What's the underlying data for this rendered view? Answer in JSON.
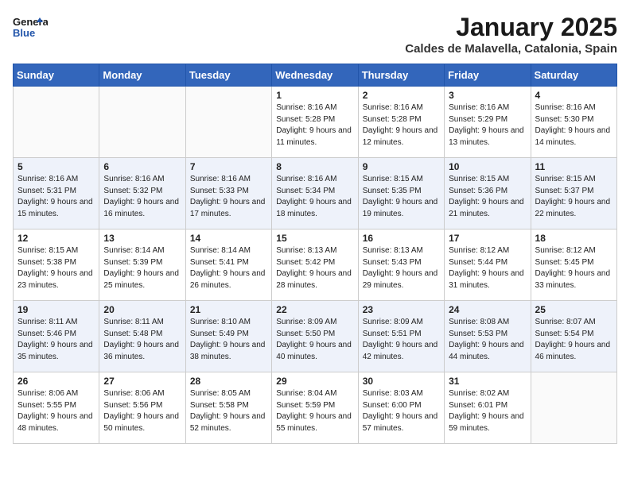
{
  "header": {
    "logo_line1": "General",
    "logo_line2": "Blue",
    "month_title": "January 2025",
    "location": "Caldes de Malavella, Catalonia, Spain"
  },
  "weekdays": [
    "Sunday",
    "Monday",
    "Tuesday",
    "Wednesday",
    "Thursday",
    "Friday",
    "Saturday"
  ],
  "weeks": [
    [
      {
        "day": "",
        "info": ""
      },
      {
        "day": "",
        "info": ""
      },
      {
        "day": "",
        "info": ""
      },
      {
        "day": "1",
        "sunrise": "8:16 AM",
        "sunset": "5:28 PM",
        "daylight": "9 hours and 11 minutes."
      },
      {
        "day": "2",
        "sunrise": "8:16 AM",
        "sunset": "5:28 PM",
        "daylight": "9 hours and 12 minutes."
      },
      {
        "day": "3",
        "sunrise": "8:16 AM",
        "sunset": "5:29 PM",
        "daylight": "9 hours and 13 minutes."
      },
      {
        "day": "4",
        "sunrise": "8:16 AM",
        "sunset": "5:30 PM",
        "daylight": "9 hours and 14 minutes."
      }
    ],
    [
      {
        "day": "5",
        "sunrise": "8:16 AM",
        "sunset": "5:31 PM",
        "daylight": "9 hours and 15 minutes."
      },
      {
        "day": "6",
        "sunrise": "8:16 AM",
        "sunset": "5:32 PM",
        "daylight": "9 hours and 16 minutes."
      },
      {
        "day": "7",
        "sunrise": "8:16 AM",
        "sunset": "5:33 PM",
        "daylight": "9 hours and 17 minutes."
      },
      {
        "day": "8",
        "sunrise": "8:16 AM",
        "sunset": "5:34 PM",
        "daylight": "9 hours and 18 minutes."
      },
      {
        "day": "9",
        "sunrise": "8:15 AM",
        "sunset": "5:35 PM",
        "daylight": "9 hours and 19 minutes."
      },
      {
        "day": "10",
        "sunrise": "8:15 AM",
        "sunset": "5:36 PM",
        "daylight": "9 hours and 21 minutes."
      },
      {
        "day": "11",
        "sunrise": "8:15 AM",
        "sunset": "5:37 PM",
        "daylight": "9 hours and 22 minutes."
      }
    ],
    [
      {
        "day": "12",
        "sunrise": "8:15 AM",
        "sunset": "5:38 PM",
        "daylight": "9 hours and 23 minutes."
      },
      {
        "day": "13",
        "sunrise": "8:14 AM",
        "sunset": "5:39 PM",
        "daylight": "9 hours and 25 minutes."
      },
      {
        "day": "14",
        "sunrise": "8:14 AM",
        "sunset": "5:41 PM",
        "daylight": "9 hours and 26 minutes."
      },
      {
        "day": "15",
        "sunrise": "8:13 AM",
        "sunset": "5:42 PM",
        "daylight": "9 hours and 28 minutes."
      },
      {
        "day": "16",
        "sunrise": "8:13 AM",
        "sunset": "5:43 PM",
        "daylight": "9 hours and 29 minutes."
      },
      {
        "day": "17",
        "sunrise": "8:12 AM",
        "sunset": "5:44 PM",
        "daylight": "9 hours and 31 minutes."
      },
      {
        "day": "18",
        "sunrise": "8:12 AM",
        "sunset": "5:45 PM",
        "daylight": "9 hours and 33 minutes."
      }
    ],
    [
      {
        "day": "19",
        "sunrise": "8:11 AM",
        "sunset": "5:46 PM",
        "daylight": "9 hours and 35 minutes."
      },
      {
        "day": "20",
        "sunrise": "8:11 AM",
        "sunset": "5:48 PM",
        "daylight": "9 hours and 36 minutes."
      },
      {
        "day": "21",
        "sunrise": "8:10 AM",
        "sunset": "5:49 PM",
        "daylight": "9 hours and 38 minutes."
      },
      {
        "day": "22",
        "sunrise": "8:09 AM",
        "sunset": "5:50 PM",
        "daylight": "9 hours and 40 minutes."
      },
      {
        "day": "23",
        "sunrise": "8:09 AM",
        "sunset": "5:51 PM",
        "daylight": "9 hours and 42 minutes."
      },
      {
        "day": "24",
        "sunrise": "8:08 AM",
        "sunset": "5:53 PM",
        "daylight": "9 hours and 44 minutes."
      },
      {
        "day": "25",
        "sunrise": "8:07 AM",
        "sunset": "5:54 PM",
        "daylight": "9 hours and 46 minutes."
      }
    ],
    [
      {
        "day": "26",
        "sunrise": "8:06 AM",
        "sunset": "5:55 PM",
        "daylight": "9 hours and 48 minutes."
      },
      {
        "day": "27",
        "sunrise": "8:06 AM",
        "sunset": "5:56 PM",
        "daylight": "9 hours and 50 minutes."
      },
      {
        "day": "28",
        "sunrise": "8:05 AM",
        "sunset": "5:58 PM",
        "daylight": "9 hours and 52 minutes."
      },
      {
        "day": "29",
        "sunrise": "8:04 AM",
        "sunset": "5:59 PM",
        "daylight": "9 hours and 55 minutes."
      },
      {
        "day": "30",
        "sunrise": "8:03 AM",
        "sunset": "6:00 PM",
        "daylight": "9 hours and 57 minutes."
      },
      {
        "day": "31",
        "sunrise": "8:02 AM",
        "sunset": "6:01 PM",
        "daylight": "9 hours and 59 minutes."
      },
      {
        "day": "",
        "info": ""
      }
    ]
  ]
}
